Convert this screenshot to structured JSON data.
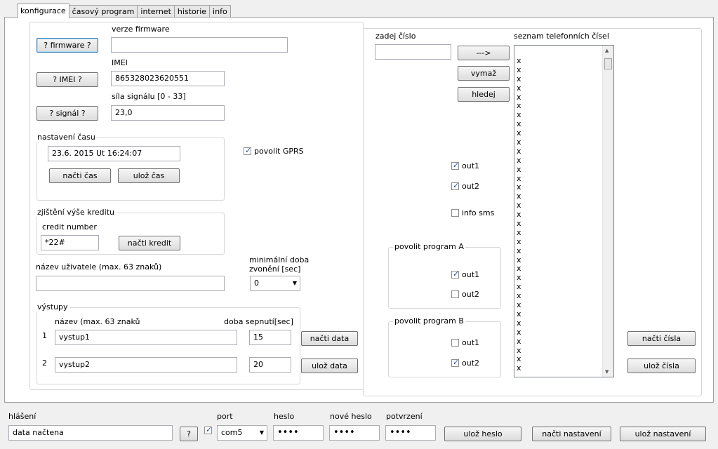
{
  "tabs": [
    "konfigurace",
    "časový program",
    "internet",
    "historie",
    "info"
  ],
  "firmware": {
    "button": "? firmware ?",
    "label": "verze firmware",
    "value": ""
  },
  "imei": {
    "button": "? IMEI ?",
    "label": "IMEI",
    "value": "865328023620551"
  },
  "signal": {
    "button": "? signál ?",
    "label": "síla signálu [0 - 33]",
    "value": "23,0"
  },
  "time": {
    "group": "nastavení času",
    "value": "23.6. 2015  Ut 16:24:07",
    "read": "načti čas",
    "save": "ulož čas"
  },
  "gprs": {
    "label": "povolit GPRS",
    "checked": true
  },
  "credit": {
    "group": "zjištění výše kreditu",
    "number_label": "credit number",
    "number": "*22#",
    "read": "načti kredit"
  },
  "user": {
    "label": "název uživatele (max. 63 znaků)",
    "value": ""
  },
  "ring": {
    "label_line1": "minimální doba",
    "label_line2": "zvonění [sec]",
    "value": "0"
  },
  "outputs": {
    "group": "výstupy",
    "name_header": "název (max.  63 znaků",
    "time_header": "doba sepnutí[sec]",
    "rows": [
      {
        "index": "1",
        "name": "vystup1",
        "time": "15"
      },
      {
        "index": "2",
        "name": "vystup2",
        "time": "20"
      }
    ],
    "read": "načti data",
    "save": "ulož data"
  },
  "phone": {
    "enter_label": "zadej číslo",
    "enter_value": "",
    "add": "--->",
    "delete": "vymaž",
    "find": "hledej",
    "out1": "out1",
    "out2": "out2",
    "info_sms": "info sms",
    "list_label": "seznam telefonních čísel",
    "read": "načti čísla",
    "save": "ulož čísla"
  },
  "program_a": {
    "group": "povolit program A",
    "out1": "out1",
    "out2": "out2"
  },
  "program_b": {
    "group": "povolit program B",
    "out1": "out1",
    "out2": "out2"
  },
  "status": {
    "label": "hlášení",
    "value": "data načtena",
    "help": "?",
    "port_label": "port",
    "port": "com5",
    "password_label": "heslo",
    "password": "••••",
    "new_password_label": "nové heslo",
    "new_password": "••••",
    "confirm_label": "potvrzení",
    "confirm": "••••",
    "save_password": "ulož heslo",
    "load_settings": "načti nastavení",
    "save_settings": "ulož nastavení"
  },
  "checkmark": "✓",
  "list_entry": "x",
  "arrow_up": "▲",
  "arrow_down": "▼"
}
